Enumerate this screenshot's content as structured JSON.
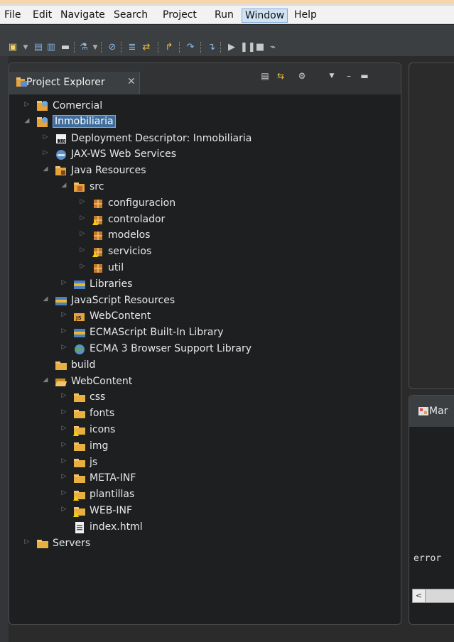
{
  "menubar": {
    "items": [
      "File",
      "Edit",
      "Navigate",
      "Search",
      "Project",
      "Run",
      "Window",
      "Help"
    ],
    "active": "Window"
  },
  "toolbar": {
    "icons": [
      "new-icon",
      "save-icon",
      "save-all-icon",
      "print-icon",
      "debug-icon",
      "skip-breakpoints-icon",
      "open-task-icon",
      "toggle-mark-icon",
      "next-annotation-icon",
      "step-into-icon",
      "step-over-icon",
      "step-return-icon",
      "resume-icon",
      "suspend-icon",
      "terminate-icon",
      "disconnect-icon"
    ]
  },
  "explorer": {
    "tab_label": "Project Explorer",
    "close_glyph": "✕",
    "header_icons": [
      "collapse-all-icon",
      "link-editor-icon",
      "filter-icon",
      "view-menu-icon",
      "minimize-icon",
      "maximize-icon"
    ]
  },
  "tree": [
    {
      "label": "Comercial",
      "depth": 0,
      "twisty": "closed",
      "icon": "web-project-icon"
    },
    {
      "label": "Inmobiliaria",
      "depth": 0,
      "twisty": "open",
      "icon": "web-project-icon",
      "selected": true
    },
    {
      "label": "Deployment Descriptor: Inmobiliaria",
      "depth": 1,
      "twisty": "closed",
      "icon": "deployment-descriptor-icon"
    },
    {
      "label": "JAX-WS Web Services",
      "depth": 1,
      "twisty": "closed",
      "icon": "web-services-icon"
    },
    {
      "label": "Java Resources",
      "depth": 1,
      "twisty": "open",
      "icon": "java-resources-icon"
    },
    {
      "label": "src",
      "depth": 2,
      "twisty": "open",
      "icon": "source-folder-icon"
    },
    {
      "label": "configuracion",
      "depth": 3,
      "twisty": "closed",
      "icon": "package-icon"
    },
    {
      "label": "controlador",
      "depth": 3,
      "twisty": "closed",
      "icon": "package-warning-icon"
    },
    {
      "label": "modelos",
      "depth": 3,
      "twisty": "closed",
      "icon": "package-icon"
    },
    {
      "label": "servicios",
      "depth": 3,
      "twisty": "closed",
      "icon": "package-warning-icon"
    },
    {
      "label": "util",
      "depth": 3,
      "twisty": "closed",
      "icon": "package-icon"
    },
    {
      "label": "Libraries",
      "depth": 2,
      "twisty": "closed",
      "icon": "libraries-icon"
    },
    {
      "label": "JavaScript Resources",
      "depth": 1,
      "twisty": "open",
      "icon": "libraries-icon"
    },
    {
      "label": "WebContent",
      "depth": 2,
      "twisty": "closed",
      "icon": "js-webcontent-icon"
    },
    {
      "label": "ECMAScript Built-In Library",
      "depth": 2,
      "twisty": "closed",
      "icon": "libraries-icon"
    },
    {
      "label": "ECMA 3 Browser Support Library",
      "depth": 2,
      "twisty": "closed",
      "icon": "globe-icon"
    },
    {
      "label": "build",
      "depth": 1,
      "twisty": "none",
      "icon": "folder-icon"
    },
    {
      "label": "WebContent",
      "depth": 1,
      "twisty": "open",
      "icon": "folder-open-icon"
    },
    {
      "label": "css",
      "depth": 2,
      "twisty": "closed",
      "icon": "folder-icon"
    },
    {
      "label": "fonts",
      "depth": 2,
      "twisty": "closed",
      "icon": "folder-icon"
    },
    {
      "label": "icons",
      "depth": 2,
      "twisty": "closed",
      "icon": "folder-warning-icon"
    },
    {
      "label": "img",
      "depth": 2,
      "twisty": "closed",
      "icon": "folder-icon"
    },
    {
      "label": "js",
      "depth": 2,
      "twisty": "closed",
      "icon": "folder-icon"
    },
    {
      "label": "META-INF",
      "depth": 2,
      "twisty": "closed",
      "icon": "folder-icon"
    },
    {
      "label": "plantillas",
      "depth": 2,
      "twisty": "closed",
      "icon": "folder-warning-icon"
    },
    {
      "label": "WEB-INF",
      "depth": 2,
      "twisty": "closed",
      "icon": "folder-warning-icon"
    },
    {
      "label": "index.html",
      "depth": 2,
      "twisty": "none",
      "icon": "html-file-icon"
    },
    {
      "label": "Servers",
      "depth": 0,
      "twisty": "closed",
      "icon": "folder-icon"
    }
  ],
  "markers_pane": {
    "tab_label": "Mar",
    "console_text": "error",
    "scroll_left_glyph": "<"
  },
  "colors": {
    "selection": "#3f6e9e",
    "background": "#1d1f21",
    "text": "#e8e8e8"
  }
}
